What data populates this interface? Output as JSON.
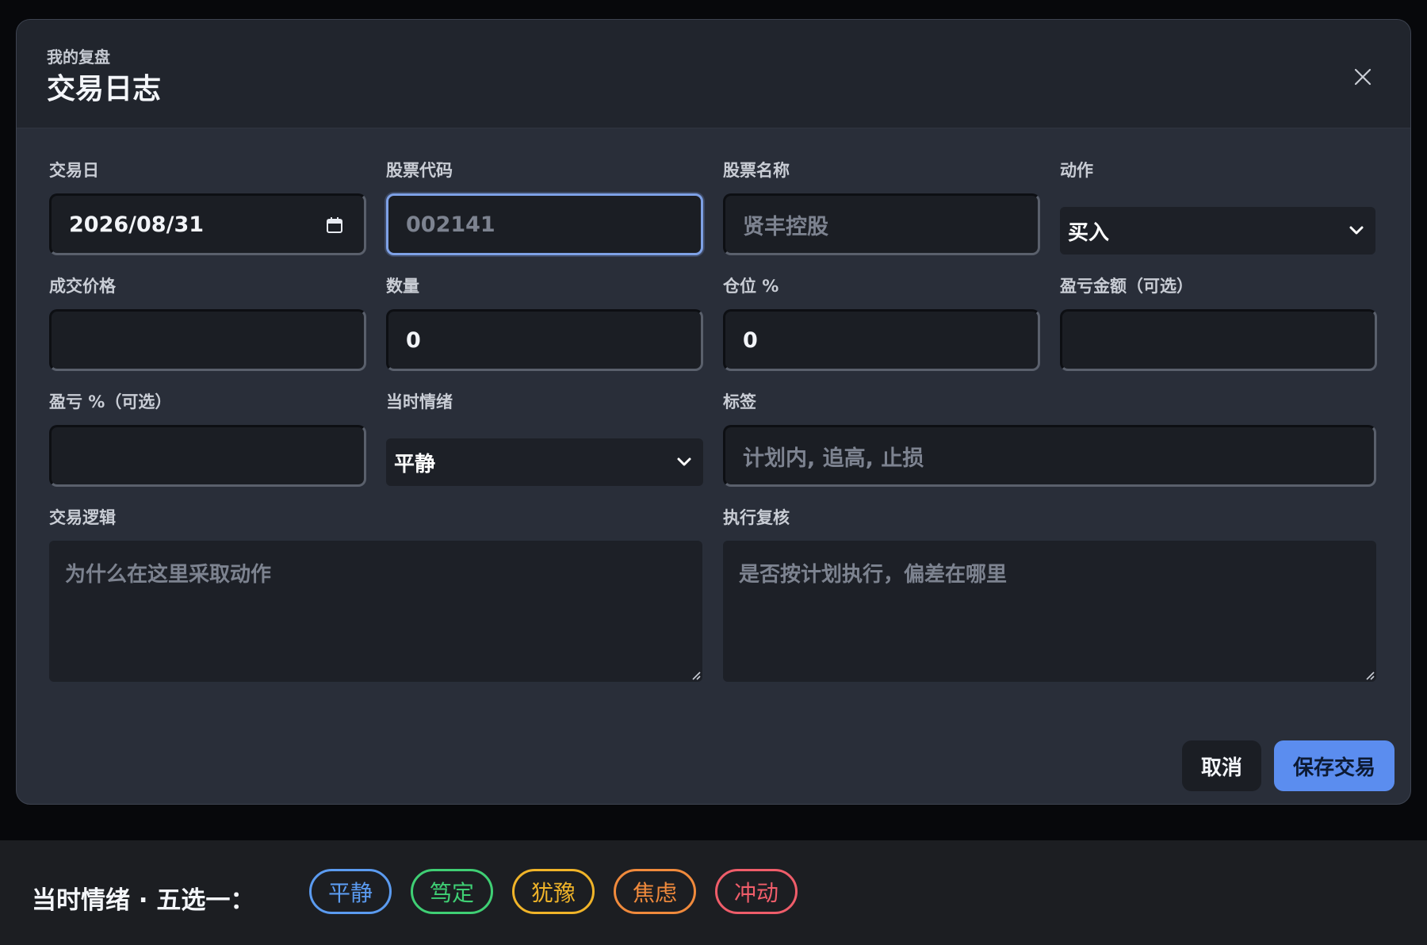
{
  "modal": {
    "eyebrow": "我的复盘",
    "title": "交易日志"
  },
  "fields": {
    "trade_date": {
      "label": "交易日",
      "value": "2026/08/31"
    },
    "stock_code": {
      "label": "股票代码",
      "placeholder": "002141"
    },
    "stock_name": {
      "label": "股票名称",
      "placeholder": "贤丰控股"
    },
    "action": {
      "label": "动作",
      "selected": "买入"
    },
    "price": {
      "label": "成交价格",
      "value": ""
    },
    "quantity": {
      "label": "数量",
      "value": "0"
    },
    "position": {
      "label": "仓位 %",
      "value": "0"
    },
    "pnl_amount": {
      "label": "盈亏金额（可选）",
      "value": ""
    },
    "pnl_percent": {
      "label": "盈亏 %（可选）",
      "value": ""
    },
    "emotion": {
      "label": "当时情绪",
      "selected": "平静"
    },
    "tags": {
      "label": "标签",
      "placeholder": "计划内, 追高, 止损"
    },
    "logic": {
      "label": "交易逻辑",
      "placeholder": "为什么在这里采取动作"
    },
    "review": {
      "label": "执行复核",
      "placeholder": "是否按计划执行，偏差在哪里"
    }
  },
  "buttons": {
    "cancel": "取消",
    "save": "保存交易"
  },
  "footer": {
    "label": "当时情绪 · 五选一：",
    "chips": [
      {
        "label": "平静",
        "color": "#5b9bf0"
      },
      {
        "label": "笃定",
        "color": "#3fcf74"
      },
      {
        "label": "犹豫",
        "color": "#f0b429"
      },
      {
        "label": "焦虑",
        "color": "#f08a3c"
      },
      {
        "label": "冲动",
        "color": "#ef5d6a"
      }
    ]
  },
  "icons": {
    "close": "close-icon",
    "calendar": "calendar-icon",
    "chevron": "chevron-down-icon"
  }
}
